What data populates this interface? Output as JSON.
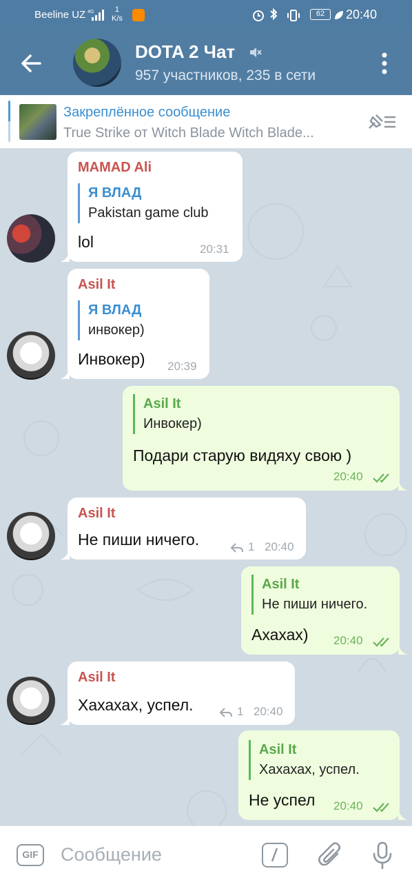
{
  "status_bar": {
    "carrier": "Beeline UZ",
    "network": "4G",
    "speed_value": "1",
    "speed_unit": "K/s",
    "battery": "62",
    "time": "20:40"
  },
  "header": {
    "title": "DOTA 2 Чат",
    "subtitle": "957 участников, 235 в сети"
  },
  "pinned": {
    "title": "Закреплённое сообщение",
    "text": "True Strike от Witch Blade  Witch Blade..."
  },
  "messages": [
    {
      "sender": "MAMAD Ali",
      "reply_name": "Я ВЛАД",
      "reply_text": "Pakistan game club",
      "text": "lol",
      "time": "20:31"
    },
    {
      "sender": "Asil It",
      "reply_name": "Я ВЛАД",
      "reply_text": "инвокер)",
      "text": "Инвокер)",
      "time": "20:39"
    },
    {
      "reply_name": "Asil It",
      "reply_text": "Инвокер)",
      "text": "Подари старую видяху свою )",
      "time": "20:40"
    },
    {
      "sender": "Asil It",
      "text": "Не пиши ничего.",
      "reply_count": "1",
      "time": "20:40"
    },
    {
      "reply_name": "Asil It",
      "reply_text": "Не пиши ничего.",
      "text": "Ахахах)",
      "time": "20:40"
    },
    {
      "sender": "Asil It",
      "text": "Хахахах, успел.",
      "reply_count": "1",
      "time": "20:40"
    },
    {
      "reply_name": "Asil It",
      "reply_text": "Хахахах, успел.",
      "text": "Не успел",
      "time": "20:40"
    }
  ],
  "input": {
    "gif_label": "GIF",
    "placeholder": "Сообщение"
  }
}
